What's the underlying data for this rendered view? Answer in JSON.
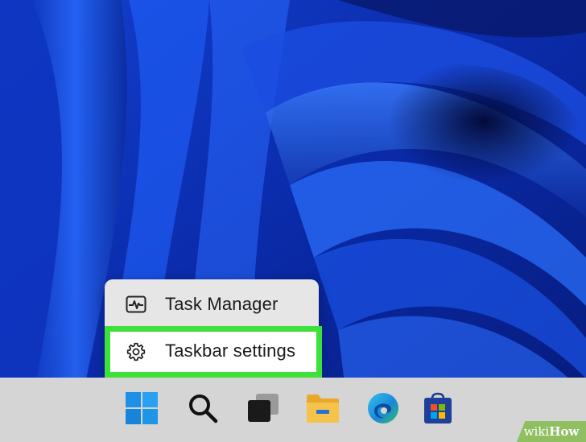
{
  "context_menu": {
    "items": [
      {
        "label": "Task Manager",
        "icon": "task-manager-icon"
      },
      {
        "label": "Taskbar settings",
        "icon": "gear-icon",
        "highlighted": true
      }
    ]
  },
  "taskbar": {
    "icons": [
      {
        "name": "start-windows-icon"
      },
      {
        "name": "search-icon"
      },
      {
        "name": "task-view-icon"
      },
      {
        "name": "file-explorer-icon"
      },
      {
        "name": "edge-browser-icon"
      },
      {
        "name": "microsoft-store-icon"
      }
    ]
  },
  "colors": {
    "highlight": "#3ee03a",
    "taskbar": "#d5d5d5",
    "menu": "#e6e6e6"
  },
  "watermark": {
    "prefix": "wiki",
    "brand": "How"
  }
}
